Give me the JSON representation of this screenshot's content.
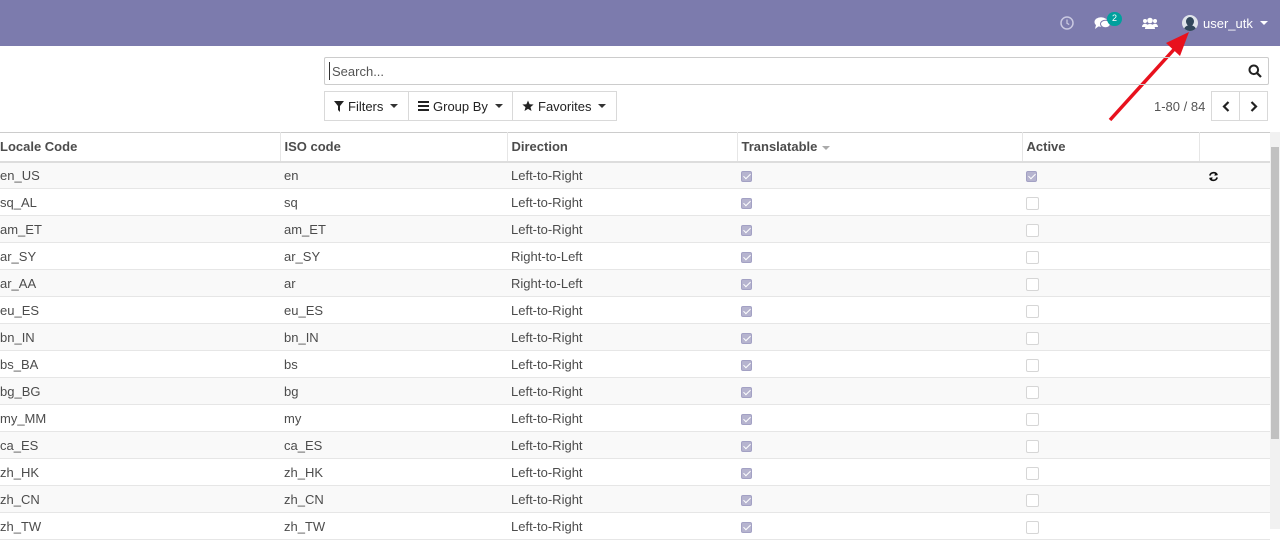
{
  "topbar": {
    "badge_count": "2",
    "username": "user_utk",
    "bg_color": "#7c7bad"
  },
  "search": {
    "placeholder": "Search..."
  },
  "controls": {
    "filters": "Filters",
    "group_by": "Group By",
    "favorites": "Favorites"
  },
  "pager": {
    "range": "1-80 / 84"
  },
  "table": {
    "headers": [
      "Locale Code",
      "ISO code",
      "Direction",
      "Translatable",
      "Active"
    ],
    "rows": [
      {
        "locale": "en_US",
        "iso": "en",
        "direction": "Left-to-Right",
        "translatable": true,
        "active": true
      },
      {
        "locale": "sq_AL",
        "iso": "sq",
        "direction": "Left-to-Right",
        "translatable": true,
        "active": false
      },
      {
        "locale": "am_ET",
        "iso": "am_ET",
        "direction": "Left-to-Right",
        "translatable": true,
        "active": false
      },
      {
        "locale": "ar_SY",
        "iso": "ar_SY",
        "direction": "Right-to-Left",
        "translatable": true,
        "active": false
      },
      {
        "locale": "ar_AA",
        "iso": "ar",
        "direction": "Right-to-Left",
        "translatable": true,
        "active": false
      },
      {
        "locale": "eu_ES",
        "iso": "eu_ES",
        "direction": "Left-to-Right",
        "translatable": true,
        "active": false
      },
      {
        "locale": "bn_IN",
        "iso": "bn_IN",
        "direction": "Left-to-Right",
        "translatable": true,
        "active": false
      },
      {
        "locale": "bs_BA",
        "iso": "bs",
        "direction": "Left-to-Right",
        "translatable": true,
        "active": false
      },
      {
        "locale": "bg_BG",
        "iso": "bg",
        "direction": "Left-to-Right",
        "translatable": true,
        "active": false
      },
      {
        "locale": "my_MM",
        "iso": "my",
        "direction": "Left-to-Right",
        "translatable": true,
        "active": false
      },
      {
        "locale": "ca_ES",
        "iso": "ca_ES",
        "direction": "Left-to-Right",
        "translatable": true,
        "active": false
      },
      {
        "locale": "zh_HK",
        "iso": "zh_HK",
        "direction": "Left-to-Right",
        "translatable": true,
        "active": false
      },
      {
        "locale": "zh_CN",
        "iso": "zh_CN",
        "direction": "Left-to-Right",
        "translatable": true,
        "active": false
      },
      {
        "locale": "zh_TW",
        "iso": "zh_TW",
        "direction": "Left-to-Right",
        "translatable": true,
        "active": false
      }
    ]
  }
}
